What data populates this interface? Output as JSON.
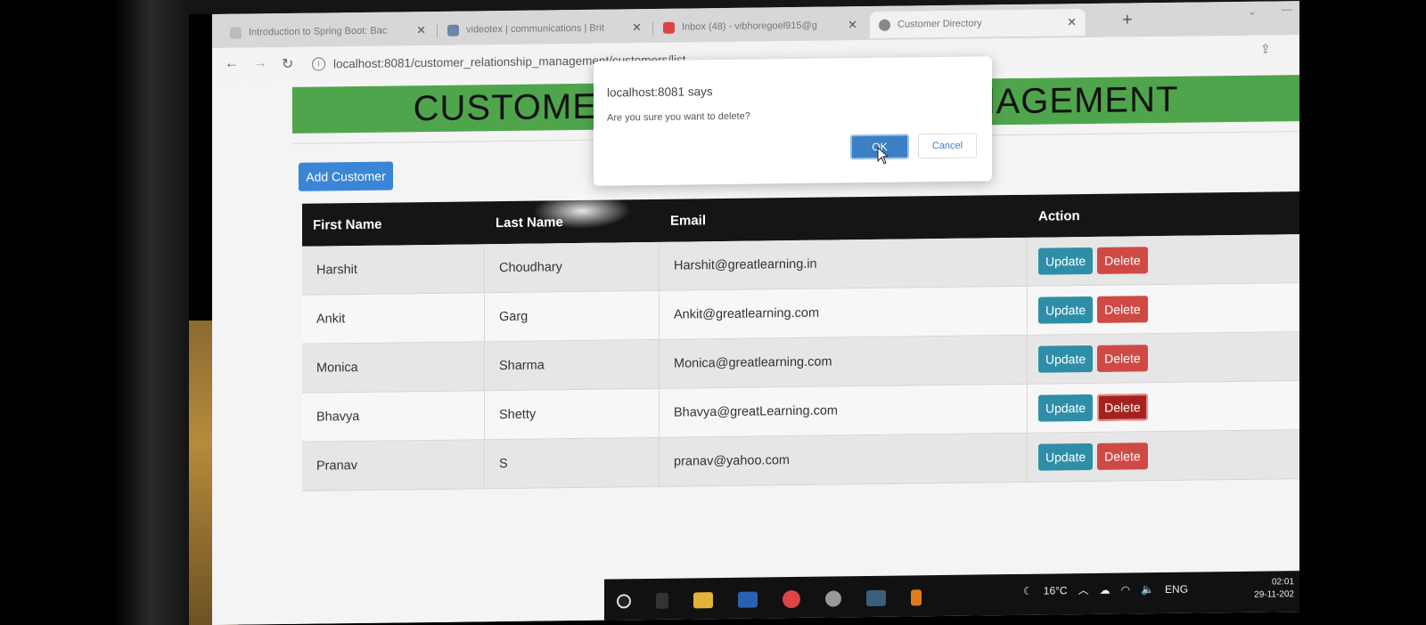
{
  "browser": {
    "tabs": [
      {
        "label": "Introduction to Spring Boot: Bac",
        "icon": "google-icon",
        "active": false
      },
      {
        "label": "videotex | communications | Brit",
        "icon": "site-icon",
        "active": false
      },
      {
        "label": "Inbox (48) - vibhoregoel915@g",
        "icon": "gmail-icon",
        "active": false
      },
      {
        "label": "Customer Directory",
        "icon": "globe-icon",
        "active": true
      }
    ],
    "url": "localhost:8081/customer_relationship_management/customers/list"
  },
  "page": {
    "banner_title": "CUSTOMER RELATIONSHIP MANAGEMENT",
    "add_button": "Add Customer",
    "table": {
      "headers": [
        "First Name",
        "Last Name",
        "Email",
        "Action"
      ],
      "rows": [
        {
          "first": "Harshit",
          "last": "Choudhary",
          "email": "Harshit@greatlearning.in"
        },
        {
          "first": "Ankit",
          "last": "Garg",
          "email": "Ankit@greatlearning.com"
        },
        {
          "first": "Monica",
          "last": "Sharma",
          "email": "Monica@greatlearning.com"
        },
        {
          "first": "Bhavya",
          "last": "Shetty",
          "email": "Bhavya@greatLearning.com"
        },
        {
          "first": "Pranav",
          "last": "S",
          "email": "pranav@yahoo.com"
        }
      ],
      "update_label": "Update",
      "delete_label": "Delete"
    }
  },
  "dialog": {
    "title": "localhost:8081 says",
    "message": "Are you sure you want to delete?",
    "ok_label": "OK",
    "cancel_label": "Cancel"
  },
  "taskbar": {
    "temperature": "16°C",
    "language": "ENG",
    "time": "02:01",
    "date": "29-11-202"
  },
  "colors": {
    "banner": "#4fa54c",
    "header_bg": "#151515",
    "update": "#2f8ea7",
    "delete": "#cf4a45",
    "add": "#3b85d6"
  }
}
